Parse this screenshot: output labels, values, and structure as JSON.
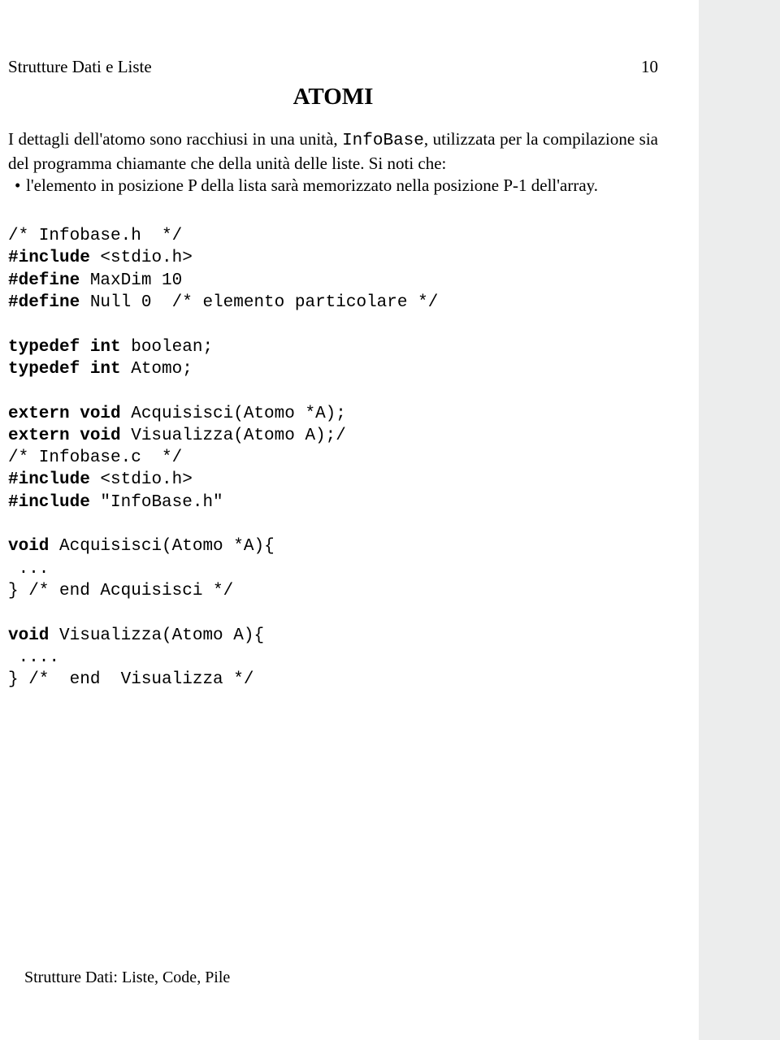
{
  "header": {
    "left": "Strutture Dati e Liste",
    "right": "10"
  },
  "title": "ATOMI",
  "para": {
    "seg1": "I dettagli dell'atomo sono racchiusi in una unità, ",
    "infobase": "InfoBase",
    "seg2": ", utilizzata per la compilazione sia del programma chiamante che della unità delle liste. Si noti che:"
  },
  "bullet": "l'elemento in posizione P della lista sarà memorizzato nella posizione P-1 dell'array.",
  "code": {
    "l01": "/* Infobase.h  */",
    "l02a": "#include",
    "l02b": " <stdio.h>",
    "l03a": "#define",
    "l03b": " MaxDim 10",
    "l04a": "#define",
    "l04b": " Null 0  /* elemento particolare */",
    "blank1": "",
    "l05a": "typedef int",
    "l05b": " boolean;",
    "l06a": "typedef int",
    "l06b": " Atomo;",
    "blank2": "",
    "l07a": "extern void",
    "l07b": " Acquisisci(Atomo *A);",
    "l08a": "extern void",
    "l08b": " Visualizza(Atomo A);/",
    "l09": "/* Infobase.c  */",
    "l10a": "#include",
    "l10b": " <stdio.h>",
    "l11a": "#include",
    "l11b": " \"InfoBase.h\"",
    "blank3": "",
    "l12a": "void",
    "l12b": " Acquisisci(Atomo *A){",
    "l13": " ...",
    "l14": "} /* end Acquisisci */",
    "blank4": "",
    "l15a": "void",
    "l15b": " Visualizza(Atomo A){",
    "l16": " ....",
    "l17": "} /*  end  Visualizza */"
  },
  "footer": "Strutture Dati: Liste, Code, Pile"
}
